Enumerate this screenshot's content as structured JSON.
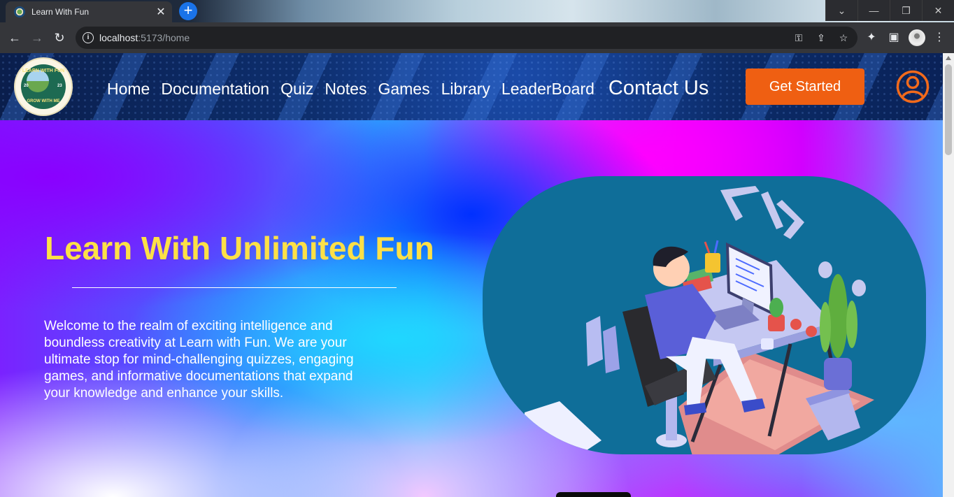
{
  "browser": {
    "tab_title": "Learn With Fun",
    "url_host": "localhost",
    "url_rest": ":5173/home",
    "new_tab_symbol": "+",
    "close_symbol": "✕"
  },
  "header": {
    "logo": {
      "top_text": "LEARN WITH FUN",
      "bottom_text": "GROW WITH ME",
      "year_left": "20",
      "year_right": "23"
    },
    "nav": [
      {
        "label": "Home"
      },
      {
        "label": "Documentation"
      },
      {
        "label": "Quiz"
      },
      {
        "label": "Notes"
      },
      {
        "label": "Games"
      },
      {
        "label": "Library"
      },
      {
        "label": "LeaderBoard"
      },
      {
        "label": "Contact Us"
      }
    ],
    "cta_label": "Get Started"
  },
  "hero": {
    "title": "Learn With Unlimited Fun",
    "description": "Welcome to the realm of exciting intelligence and boundless creativity at Learn with Fun. We are your ultimate stop for mind-challenging quizzes, engaging games, and informative documentations that expand your knowledge and enhance your skills."
  },
  "icons": {
    "user": "user-circle-icon",
    "back": "arrow-left-icon",
    "forward": "arrow-right-icon",
    "reload": "reload-icon"
  },
  "colors": {
    "accent_orange": "#ef5f12",
    "title_yellow": "#fde047",
    "header_navy": "#0d2d6b",
    "illustration_teal": "#0f6e99"
  }
}
